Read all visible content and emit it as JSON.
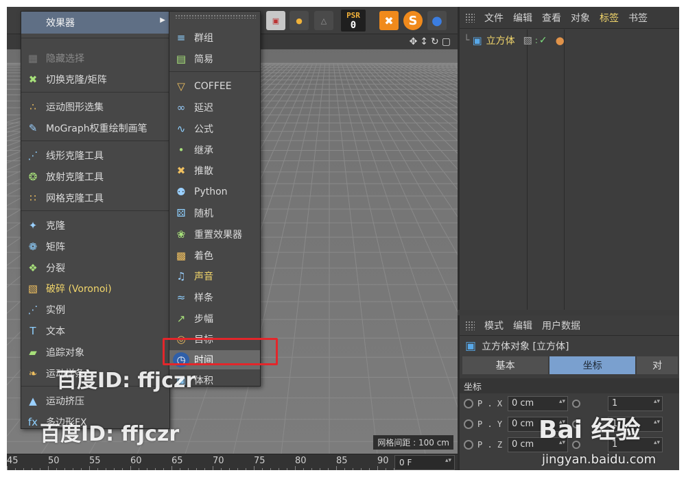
{
  "toolbar": {
    "psr_label": "PSR",
    "psr_value": "0"
  },
  "viewport": {
    "grid_spacing": "网格间距 : 100 cm"
  },
  "timeline": {
    "ticks": [
      "45",
      "50",
      "55",
      "60",
      "65",
      "70",
      "75",
      "80",
      "85",
      "90"
    ],
    "frame_value": "0 F"
  },
  "menu_left": {
    "header": "效果器",
    "items": [
      {
        "label": "隐藏选择",
        "icon": "hide-selection-icon",
        "disabled": true
      },
      {
        "label": "切换克隆/矩阵",
        "icon": "toggle-clone-matrix-icon"
      },
      {
        "label": "运动图形选集",
        "icon": "mograph-selection-icon"
      },
      {
        "label": "MoGraph权重绘制画笔",
        "icon": "weight-paint-brush-icon"
      },
      {
        "label": "线形克隆工具",
        "icon": "linear-clone-icon"
      },
      {
        "label": "放射克隆工具",
        "icon": "radial-clone-icon"
      },
      {
        "label": "网格克隆工具",
        "icon": "grid-clone-icon"
      },
      {
        "label": "克隆",
        "icon": "cloner-icon"
      },
      {
        "label": "矩阵",
        "icon": "matrix-icon"
      },
      {
        "label": "分裂",
        "icon": "fracture-icon"
      },
      {
        "label": "破碎 (Voronoi)",
        "icon": "voronoi-fracture-icon",
        "yellow": true
      },
      {
        "label": "实例",
        "icon": "instance-icon"
      },
      {
        "label": "文本",
        "icon": "text-icon"
      },
      {
        "label": "追踪对象",
        "icon": "tracer-icon"
      },
      {
        "label": "运动样条",
        "icon": "motion-spline-icon"
      },
      {
        "label": "运动挤压",
        "icon": "motion-extrude-icon"
      },
      {
        "label": "多边形FX",
        "icon": "polyfx-icon"
      }
    ]
  },
  "menu_right": {
    "items": [
      {
        "label": "群组",
        "icon": "group-effector-icon"
      },
      {
        "label": "简易",
        "icon": "plain-effector-icon"
      },
      {
        "label": "COFFEE",
        "icon": "coffee-effector-icon"
      },
      {
        "label": "延迟",
        "icon": "delay-effector-icon"
      },
      {
        "label": "公式",
        "icon": "formula-effector-icon"
      },
      {
        "label": "继承",
        "icon": "inheritance-effector-icon"
      },
      {
        "label": "推散",
        "icon": "push-apart-effector-icon"
      },
      {
        "label": "Python",
        "icon": "python-effector-icon"
      },
      {
        "label": "随机",
        "icon": "random-effector-icon"
      },
      {
        "label": "重置效果器",
        "icon": "reeffector-icon"
      },
      {
        "label": "着色",
        "icon": "shader-effector-icon"
      },
      {
        "label": "声音",
        "icon": "sound-effector-icon",
        "yellow": true
      },
      {
        "label": "样条",
        "icon": "spline-effector-icon"
      },
      {
        "label": "步幅",
        "icon": "step-effector-icon"
      },
      {
        "label": "目标",
        "icon": "target-effector-icon"
      },
      {
        "label": "时间",
        "icon": "time-effector-icon",
        "highlighted": true
      },
      {
        "label": "体积",
        "icon": "volume-effector-icon"
      }
    ]
  },
  "object_manager": {
    "menu": [
      "文件",
      "编辑",
      "查看",
      "对象",
      "标签",
      "书签"
    ],
    "active_menu": "标签",
    "object_name": "立方体"
  },
  "attribute_manager": {
    "menu": [
      "模式",
      "编辑",
      "用户数据"
    ],
    "title": "立方体对象 [立方体]",
    "tabs": [
      "基本",
      "坐标",
      "对"
    ],
    "active_tab": "坐标",
    "section": "坐标",
    "rows": [
      {
        "label": "P . X",
        "value": "0 cm",
        "value2": "1"
      },
      {
        "label": "P . Y",
        "value": "0 cm",
        "value2": "1"
      },
      {
        "label": "P . Z",
        "value": "0 cm",
        "value2": "1"
      }
    ]
  },
  "watermarks": {
    "baidu_id_1": "百度ID: ffjczr",
    "baidu_id_2": "百度ID: ffjczr",
    "logo": "Bai 经验",
    "url": "jingyan.baidu.com"
  },
  "colors": {
    "highlight_box": "#e3262b",
    "active_tab": "#7aa0cf",
    "accent_text": "#f2d66b"
  }
}
